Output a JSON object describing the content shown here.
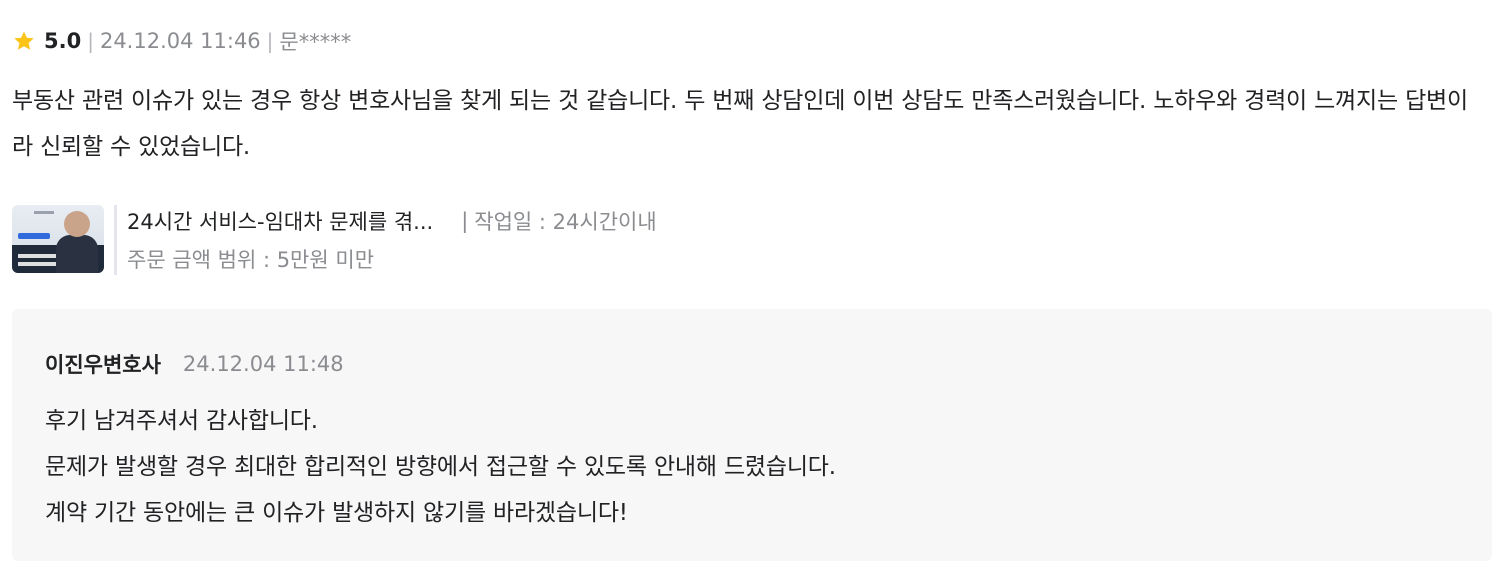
{
  "review": {
    "score": "5.0",
    "date": "24.12.04 11:46",
    "author": "문*****",
    "text": "부동산 관련 이슈가 있는 경우 항상 변호사님을 찾게 되는 것 같습니다. 두 번째 상담인데 이번 상담도 만족스러웠습니다. 노하우와 경력이 느껴지는 답변이라 신뢰할 수 있었습니다."
  },
  "service": {
    "thumbnail_icon": "lawyer-thumbnail",
    "title": "24시간 서비스-임대차 문제를 겪...",
    "work_period": "작업일 : 24시간이내",
    "price_range": "주문 금액 범위 : 5만원 미만"
  },
  "reply": {
    "author": "이진우변호사",
    "date": "24.12.04 11:48",
    "lines": [
      "후기 남겨주셔서 감사합니다.",
      "문제가 발생할 경우 최대한 합리적인 방향에서 접근할 수 있도록 안내해 드렸습니다.",
      "계약 기간 동안에는 큰 이슈가 발생하지 않기를 바라겠습니다!"
    ]
  },
  "colors": {
    "star": "#fcc419",
    "text_primary": "#212224",
    "text_secondary": "#8a8c90",
    "reply_bg": "#f7f7f8"
  }
}
